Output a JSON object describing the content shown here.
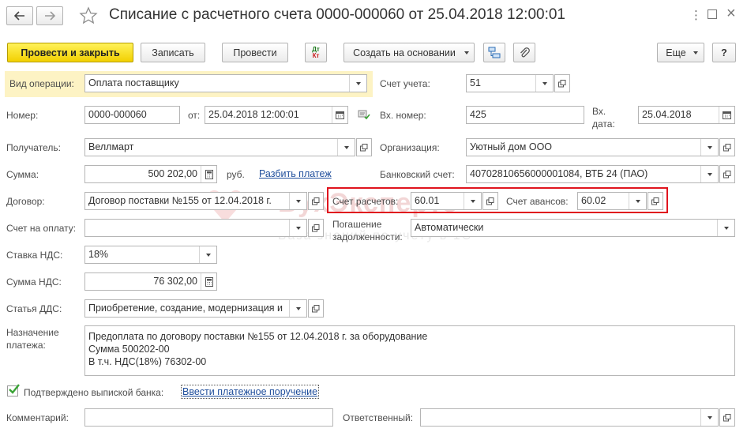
{
  "window": {
    "title": "Списание с расчетного счета 0000-000060 от 25.04.2018 12:00:01"
  },
  "toolbar": {
    "post_close": "Провести и закрыть",
    "save": "Записать",
    "post": "Провести",
    "dtkt_top": "Дт",
    "dtkt_bottom": "Кт",
    "create_based": "Создать на основании",
    "more": "Еще",
    "help": "?"
  },
  "form": {
    "operation_type": {
      "label": "Вид операции:",
      "value": "Оплата поставщику"
    },
    "account": {
      "label": "Счет учета:",
      "value": "51"
    },
    "number": {
      "label": "Номер:",
      "value": "0000-000060"
    },
    "date": {
      "label": "от:",
      "value": "25.04.2018 12:00:01"
    },
    "incoming_number": {
      "label": "Вх. номер:",
      "value": "425"
    },
    "incoming_date": {
      "label_line1": "Вх.",
      "label_line2": "дата:",
      "value": "25.04.2018"
    },
    "recipient": {
      "label": "Получатель:",
      "value": "Веллмарт"
    },
    "organization": {
      "label": "Организация:",
      "value": "Уютный дом ООО"
    },
    "amount": {
      "label": "Сумма:",
      "value": "500 202,00",
      "currency": "руб.",
      "split_link": "Разбить платеж"
    },
    "bank_account": {
      "label": "Банковский счет:",
      "value": "40702810656000001084, ВТБ 24 (ПАО)"
    },
    "contract": {
      "label": "Договор:",
      "value": "Договор поставки №155 от 12.04.2018 г."
    },
    "settlement_account": {
      "label": "Счет расчетов:",
      "value": "60.01"
    },
    "advance_account": {
      "label": "Счет авансов:",
      "value": "60.02"
    },
    "invoice": {
      "label": "Счет на оплату:",
      "value": ""
    },
    "debt_repayment": {
      "label_line1": "Погашение",
      "label_line2": "задолженности:",
      "value": "Автоматически"
    },
    "vat_rate": {
      "label": "Ставка НДС:",
      "value": "18%"
    },
    "vat_amount": {
      "label": "Сумма НДС:",
      "value": "76 302,00"
    },
    "cash_flow_item": {
      "label": "Статья ДДС:",
      "value": "Приобретение, создание, модернизация и"
    },
    "purpose": {
      "label_line1": "Назначение",
      "label_line2": "платежа:",
      "lines": [
        "Предоплата по договору  поставки №155 от 12.04.2018 г. за оборудование",
        "Сумма 500202-00",
        "В т.ч. НДС(18%) 76302-00"
      ]
    },
    "confirmed": {
      "label": "Подтверждено выпиской банка:",
      "checked": true,
      "link": "Ввести платежное поручение"
    },
    "comment": {
      "label": "Комментарий:",
      "value": ""
    },
    "responsible": {
      "label": "Ответственный:",
      "value": ""
    }
  },
  "watermark": {
    "name": "БухЭксперт8",
    "tagline": "База знаний по учету в 1С"
  },
  "colors": {
    "primary_button": "#f2d000",
    "highlight_row": "#fdf3c4",
    "red_frame": "#e0141e",
    "link": "#1f4e9c",
    "check": "#3aa335"
  }
}
